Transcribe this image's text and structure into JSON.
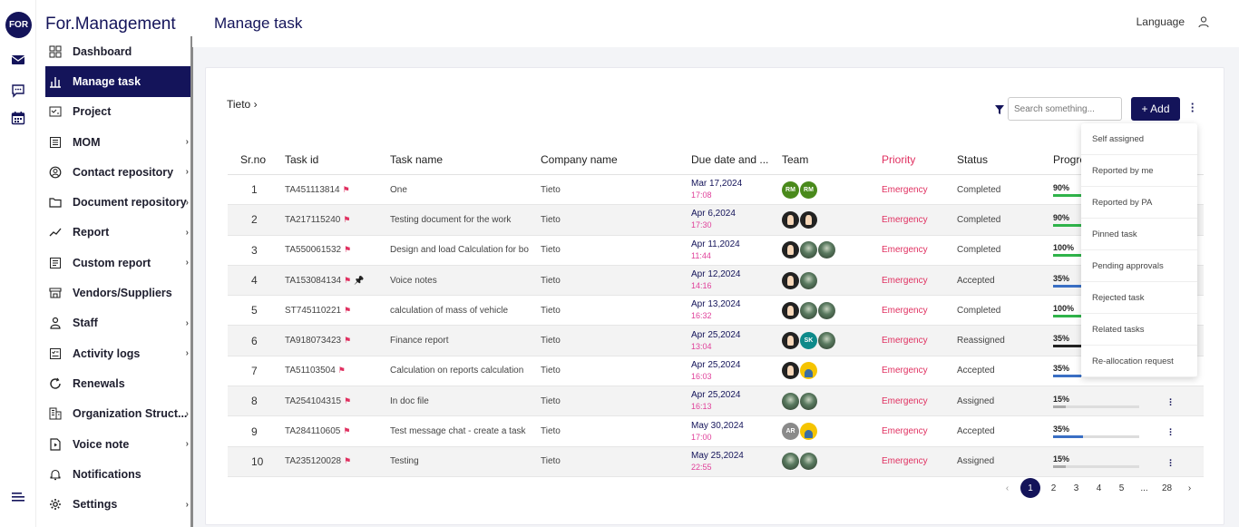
{
  "app": {
    "logo": "FOR",
    "brand": "For.Management",
    "page_title": "Manage task",
    "language_label": "Language"
  },
  "rail_icons": [
    "mail-icon",
    "chat-icon",
    "calendar-icon",
    "menu-icon"
  ],
  "sidebar": {
    "items": [
      {
        "label": "Dashboard",
        "icon": "dashboard-icon",
        "chevron": false,
        "active": false
      },
      {
        "label": "Manage task",
        "icon": "chart-icon",
        "chevron": false,
        "active": true
      },
      {
        "label": "Project",
        "icon": "project-icon",
        "chevron": false,
        "active": false
      },
      {
        "label": "MOM",
        "icon": "list-icon",
        "chevron": true,
        "active": false
      },
      {
        "label": "Contact repository",
        "icon": "contact-icon",
        "chevron": true,
        "active": false
      },
      {
        "label": "Document repository",
        "icon": "folder-icon",
        "chevron": true,
        "active": false
      },
      {
        "label": "Report",
        "icon": "trend-icon",
        "chevron": true,
        "active": false
      },
      {
        "label": "Custom report",
        "icon": "report-icon",
        "chevron": true,
        "active": false
      },
      {
        "label": "Vendors/Suppliers",
        "icon": "store-icon",
        "chevron": false,
        "active": false
      },
      {
        "label": "Staff",
        "icon": "staff-icon",
        "chevron": true,
        "active": false
      },
      {
        "label": "Activity logs",
        "icon": "activity-icon",
        "chevron": true,
        "active": false
      },
      {
        "label": "Renewals",
        "icon": "renew-icon",
        "chevron": false,
        "active": false
      },
      {
        "label": "Organization Struct...",
        "icon": "org-icon",
        "chevron": true,
        "active": false
      },
      {
        "label": "Voice note",
        "icon": "voice-icon",
        "chevron": true,
        "active": false
      },
      {
        "label": "Notifications",
        "icon": "bell-icon",
        "chevron": false,
        "active": false
      },
      {
        "label": "Settings",
        "icon": "gear-icon",
        "chevron": true,
        "active": false
      }
    ]
  },
  "toolbar": {
    "breadcrumb": "Tieto",
    "search_placeholder": "Search something...",
    "add_label": "+ Add"
  },
  "table": {
    "headers": [
      "Sr.no",
      "Task id",
      "Task name",
      "Company name",
      "Due date and ...",
      "Team",
      "Priority",
      "Status",
      "Progre"
    ],
    "rows": [
      {
        "sr": "1",
        "id": "TA451113814",
        "marker": "flag",
        "name": "One",
        "company": "Tieto",
        "date": "Mar 17,2024",
        "time": "17:08",
        "team": [
          "RM:green",
          "RM:green"
        ],
        "priority": "Emergency",
        "status": "Completed",
        "progress": "90%",
        "fill": 0.9,
        "bar_color": "#2fb34a"
      },
      {
        "sr": "2",
        "id": "TA217115240",
        "marker": "flag",
        "name": "Testing document for the work",
        "company": "Tieto",
        "date": "Apr 6,2024",
        "time": "17:30",
        "team": [
          ":person",
          ":person"
        ],
        "priority": "Emergency",
        "status": "Completed",
        "progress": "90%",
        "fill": 0.9,
        "bar_color": "#2fb34a"
      },
      {
        "sr": "3",
        "id": "TA550061532",
        "marker": "flag",
        "name": "Design and load Calculation for bo",
        "company": "Tieto",
        "date": "Apr 11,2024",
        "time": "11:44",
        "team": [
          ":person",
          ":photo",
          ":photo"
        ],
        "priority": "Emergency",
        "status": "Completed",
        "progress": "100%",
        "fill": 1.0,
        "bar_color": "#2fb34a"
      },
      {
        "sr": "4",
        "id": "TA153084134",
        "marker": "flag-pin",
        "name": "Voice notes",
        "company": "Tieto",
        "date": "Apr 12,2024",
        "time": "14:16",
        "team": [
          ":person",
          ":photo"
        ],
        "priority": "Emergency",
        "status": "Accepted",
        "progress": "35%",
        "fill": 0.35,
        "bar_color": "#3a6fc4"
      },
      {
        "sr": "5",
        "id": "ST745110221",
        "marker": "flag",
        "name": "calculation of mass of vehicle",
        "company": "Tieto",
        "date": "Apr 13,2024",
        "time": "16:32",
        "team": [
          ":person",
          ":photo",
          ":photo"
        ],
        "priority": "Emergency",
        "status": "Completed",
        "progress": "100%",
        "fill": 1.0,
        "bar_color": "#2fb34a"
      },
      {
        "sr": "6",
        "id": "TA918073423",
        "marker": "flag",
        "name": "Finance report",
        "company": "Tieto",
        "date": "Apr 25,2024",
        "time": "13:04",
        "team": [
          ":person",
          "SK:teal",
          ":photo"
        ],
        "priority": "Emergency",
        "status": "Reassigned",
        "progress": "35%",
        "fill": 0.35,
        "bar_color": "#222222"
      },
      {
        "sr": "7",
        "id": "TA51103504",
        "marker": "flag",
        "name": "Calculation on reports calculation",
        "company": "Tieto",
        "date": "Apr 25,2024",
        "time": "16:03",
        "team": [
          ":person",
          ":yellow"
        ],
        "priority": "Emergency",
        "status": "Accepted",
        "progress": "35%",
        "fill": 0.35,
        "bar_color": "#3a6fc4"
      },
      {
        "sr": "8",
        "id": "TA254104315",
        "marker": "flag",
        "name": "In doc file",
        "company": "Tieto",
        "date": "Apr 25,2024",
        "time": "16:13",
        "team": [
          ":photo",
          ":photo"
        ],
        "priority": "Emergency",
        "status": "Assigned",
        "progress": "15%",
        "fill": 0.15,
        "bar_color": "#aaaaaa"
      },
      {
        "sr": "9",
        "id": "TA284110605",
        "marker": "flag",
        "name": "Test message chat - create a task",
        "company": "Tieto",
        "date": "May 30,2024",
        "time": "17:00",
        "team": [
          "AR:grey",
          ":yellow"
        ],
        "priority": "Emergency",
        "status": "Accepted",
        "progress": "35%",
        "fill": 0.35,
        "bar_color": "#3a6fc4"
      },
      {
        "sr": "10",
        "id": "TA235120028",
        "marker": "flag",
        "name": "Testing",
        "company": "Tieto",
        "date": "May 25,2024",
        "time": "22:55",
        "team": [
          ":photo",
          ":photo"
        ],
        "priority": "Emergency",
        "status": "Assigned",
        "progress": "15%",
        "fill": 0.15,
        "bar_color": "#aaaaaa"
      }
    ]
  },
  "dropdown": {
    "items": [
      "Self assigned",
      "Reported by me",
      "Reported by PA",
      "Pinned task",
      "Pending approvals",
      "Rejected task",
      "Related tasks",
      "Re-allocation request"
    ]
  },
  "pagination": {
    "pages": [
      "1",
      "2",
      "3",
      "4",
      "5",
      "...",
      "28"
    ],
    "current": "1",
    "prev": "‹",
    "next": "›"
  }
}
